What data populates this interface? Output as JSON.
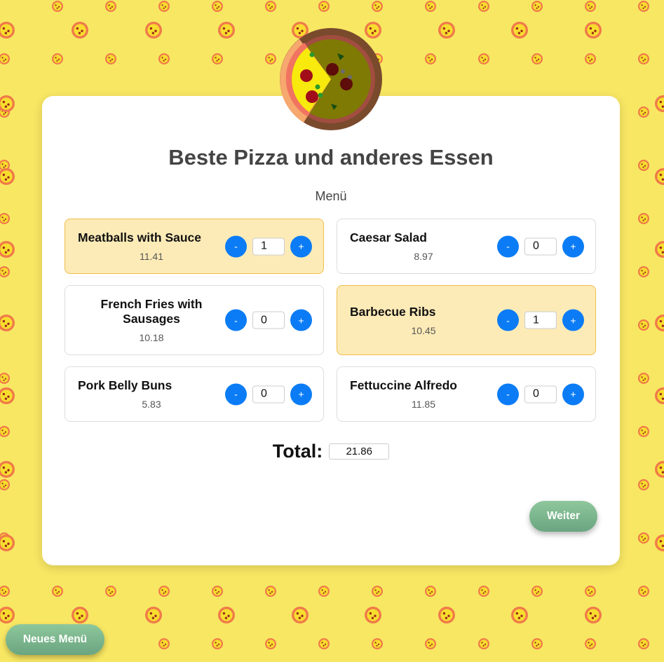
{
  "title": "Beste Pizza und anderes Essen",
  "subtitle": "Menü",
  "menu": {
    "items": [
      {
        "name": "Meatballs with Sauce",
        "price": "11.41",
        "quantity": "1",
        "selected": true
      },
      {
        "name": "Caesar Salad",
        "price": "8.97",
        "quantity": "0",
        "selected": false
      },
      {
        "name": "French Fries with Sausages",
        "price": "10.18",
        "quantity": "0",
        "selected": false
      },
      {
        "name": "Barbecue Ribs",
        "price": "10.45",
        "quantity": "1",
        "selected": true
      },
      {
        "name": "Pork Belly Buns",
        "price": "5.83",
        "quantity": "0",
        "selected": false
      },
      {
        "name": "Fettuccine Alfredo",
        "price": "11.85",
        "quantity": "0",
        "selected": false
      }
    ],
    "minus_label": "-",
    "plus_label": "+"
  },
  "total": {
    "label": "Total:",
    "value": "21.86"
  },
  "buttons": {
    "next": "Weiter",
    "new_menu": "Neues Menü"
  },
  "colors": {
    "background": "#f8e763",
    "accent": "#0b7cf5",
    "selected_fill": "#fdebb7",
    "selected_border": "#efbe4a",
    "button_green": "#7ab58d"
  },
  "icons": {
    "logo": "pizza-icon",
    "pattern": "pizza-pattern"
  }
}
